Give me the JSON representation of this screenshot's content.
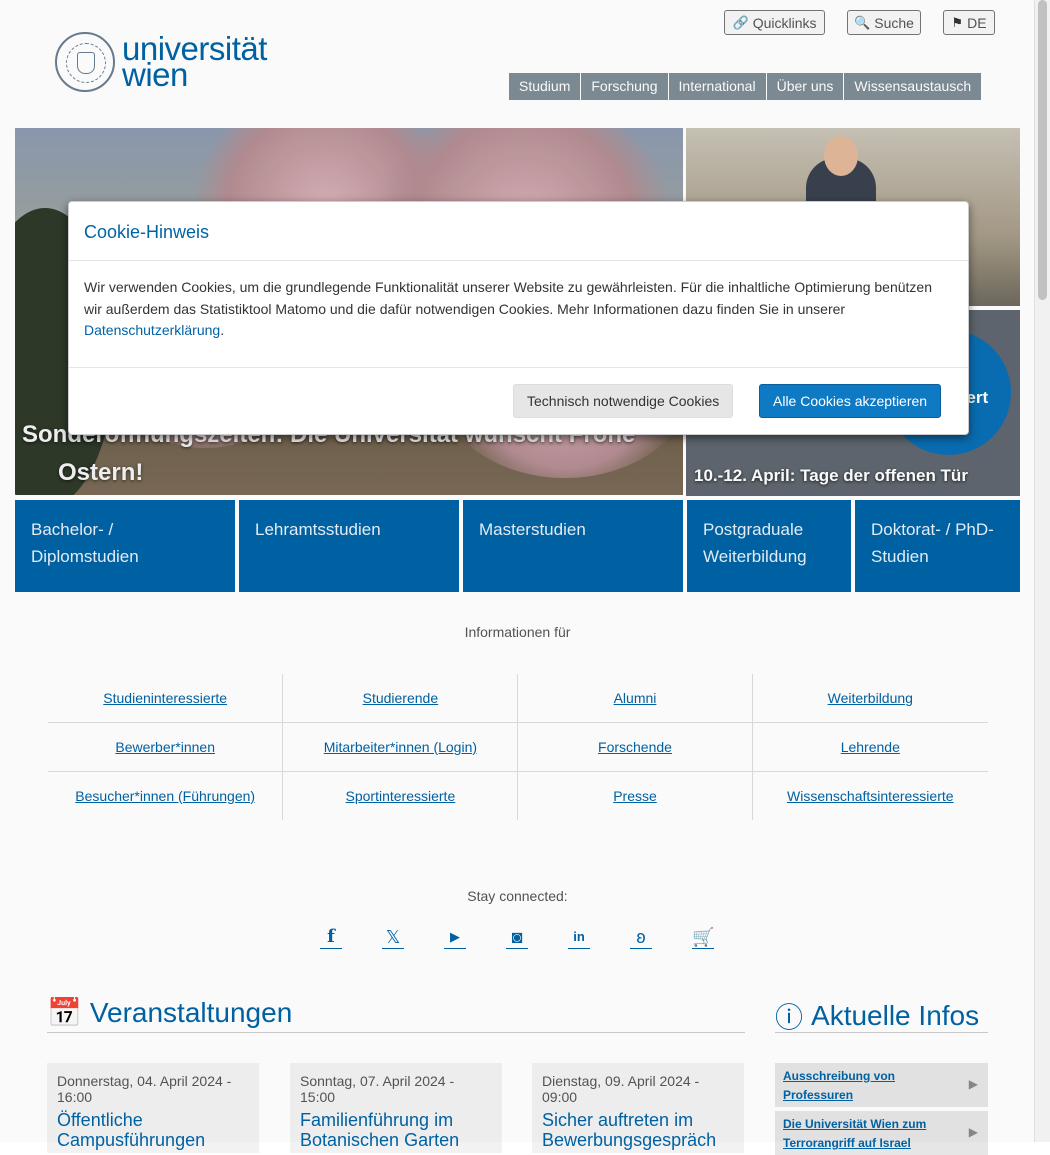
{
  "header": {
    "logo_line1": "universität",
    "logo_line2": "wien",
    "quicklinks_label": "Quicklinks",
    "search_label": "Suche",
    "language_label": "DE",
    "nav": [
      "Studium",
      "Forschung",
      "International",
      "Über uns",
      "Wissensaustausch"
    ]
  },
  "hero": {
    "main_title_line1": "Sonderöffnungszeiten: Die Universität wünscht Frohe",
    "main_title_line2": "Ostern!",
    "side2_badge": "tiert",
    "side2_caption": "10.-12. April: Tage der offenen Tür"
  },
  "tiles": [
    "Bachelor- / Diplomstudien",
    "Lehramtsstudien",
    "Masterstudien",
    "Postgraduale Weiterbildung",
    "Doktorat- / PhD-Studien"
  ],
  "info_for": {
    "heading": "Informationen für",
    "rows": [
      [
        "Studieninteressierte",
        "Studierende",
        "Alumni",
        "Weiterbildung"
      ],
      [
        "Bewerber*innen",
        "Mitarbeiter*innen (Login)",
        "Forschende",
        "Lehrende"
      ],
      [
        "Besucher*innen (Führungen)",
        "Sportinteressierte",
        "Presse",
        "Wissenschaftsinteressierte"
      ]
    ]
  },
  "social": {
    "heading": "Stay connected:",
    "icons": [
      "facebook-icon",
      "x-icon",
      "youtube-icon",
      "instagram-icon",
      "linkedin-icon",
      "bluesky-icon",
      "shop-cart-icon"
    ]
  },
  "events": {
    "heading": "Veranstaltungen",
    "items": [
      {
        "date": "Donnerstag, 04. April 2024 - 16:00",
        "title": "Öffentliche Campusführungen"
      },
      {
        "date": "Sonntag, 07. April 2024 - 15:00",
        "title": "Familienführung im Botanischen Garten"
      },
      {
        "date": "Dienstag, 09. April 2024 - 09:00",
        "title": "Sicher auftreten im Bewerbungsgespräch"
      }
    ]
  },
  "news": {
    "heading": "Aktuelle Infos",
    "items": [
      "Ausschreibung von Professuren",
      "Die Universität Wien zum Terrorangriff auf Israel"
    ]
  },
  "cookie_modal": {
    "title": "Cookie-Hinweis",
    "body": "Wir verwenden Cookies, um die grundlegende Funktionalität unserer Website zu gewährleisten. Für die inhaltliche Optimierung benützen wir außerdem das Statistiktool Matomo und die dafür notwendigen Cookies. Mehr Informationen dazu finden Sie in unserer ",
    "link": "Datenschutzerklärung",
    "body_end": ".",
    "btn_necessary": "Technisch notwendige Cookies",
    "btn_accept_all": "Alle Cookies akzeptieren"
  },
  "colors": {
    "brand_blue": "#0063a6",
    "nav_gray": "#7e8c96",
    "accept_button": "#0f7ac4"
  }
}
